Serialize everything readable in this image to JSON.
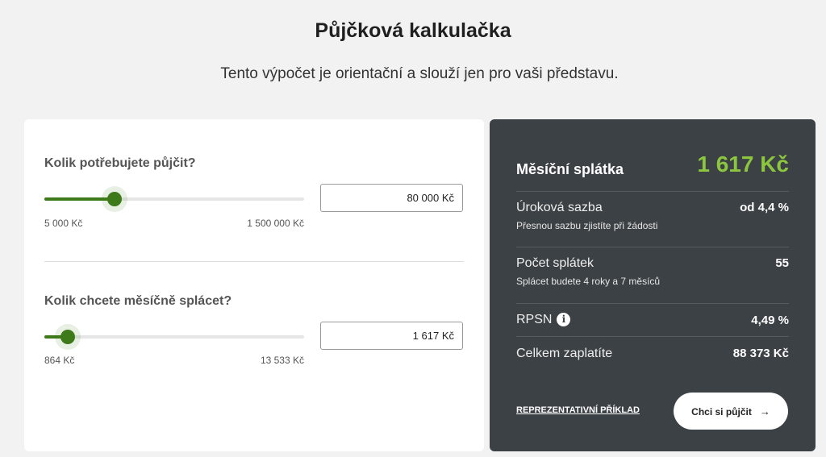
{
  "header": {
    "title": "Půjčková kalkulačka",
    "subtitle": "Tento výpočet je orientační a slouží jen pro vaši představu."
  },
  "loan_amount": {
    "question": "Kolik potřebujete půjčit?",
    "value": "80 000 Kč",
    "min_label": "5 000 Kč",
    "max_label": "1 500 000 Kč",
    "slider_fraction": 0.27
  },
  "monthly_payment_input": {
    "question": "Kolik chcete měsíčně splácet?",
    "value": "1 617 Kč",
    "min_label": "864 Kč",
    "max_label": "13 533 Kč",
    "slider_fraction": 0.09
  },
  "summary": {
    "monthly_label": "Měsíční splátka",
    "monthly_value": "1 617 Kč",
    "rate_label": "Úroková sazba",
    "rate_value": "od 4,4 %",
    "rate_note": "Přesnou sazbu zjistíte při žádosti",
    "count_label": "Počet splátek",
    "count_value": "55",
    "count_note": "Splácet budete 4 roky a 7 měsíců",
    "rpsn_label": "RPSN",
    "rpsn_value": "4,49 %",
    "total_label": "Celkem zaplatíte",
    "total_value": "88 373 Kč",
    "example_link": "REPREZENTATIVNÍ PŘÍKLAD",
    "cta_label": "Chci si půjčit"
  },
  "icons": {
    "info": "info-icon",
    "arrow": "arrow-right-icon"
  },
  "colors": {
    "accent_green": "#3f7a1a",
    "highlight_green": "#8cc63f",
    "summary_bg": "#3c4145",
    "page_bg": "#f2f2f2"
  }
}
